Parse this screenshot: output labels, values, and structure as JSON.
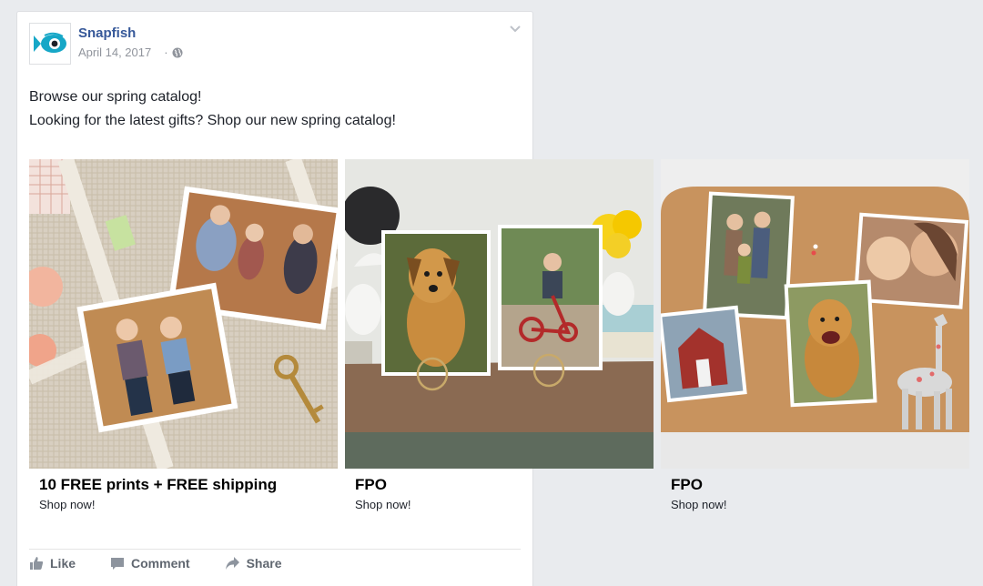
{
  "post": {
    "page_name": "Snapfish",
    "date": "April 14, 2017",
    "message_lines": [
      "Browse our spring catalog!",
      "Looking for the latest gifts? Shop our new spring catalog!"
    ]
  },
  "carousel": [
    {
      "headline": "10 FREE prints + FREE shipping",
      "cta": "Shop now!"
    },
    {
      "headline": "FPO",
      "cta": "Shop now!"
    },
    {
      "headline": "FPO",
      "cta": "Shop now!"
    }
  ],
  "actions": {
    "like": "Like",
    "comment": "Comment",
    "share": "Share"
  },
  "colors": {
    "link": "#365899",
    "meta": "#90949c",
    "brand": "#16a7c7"
  }
}
